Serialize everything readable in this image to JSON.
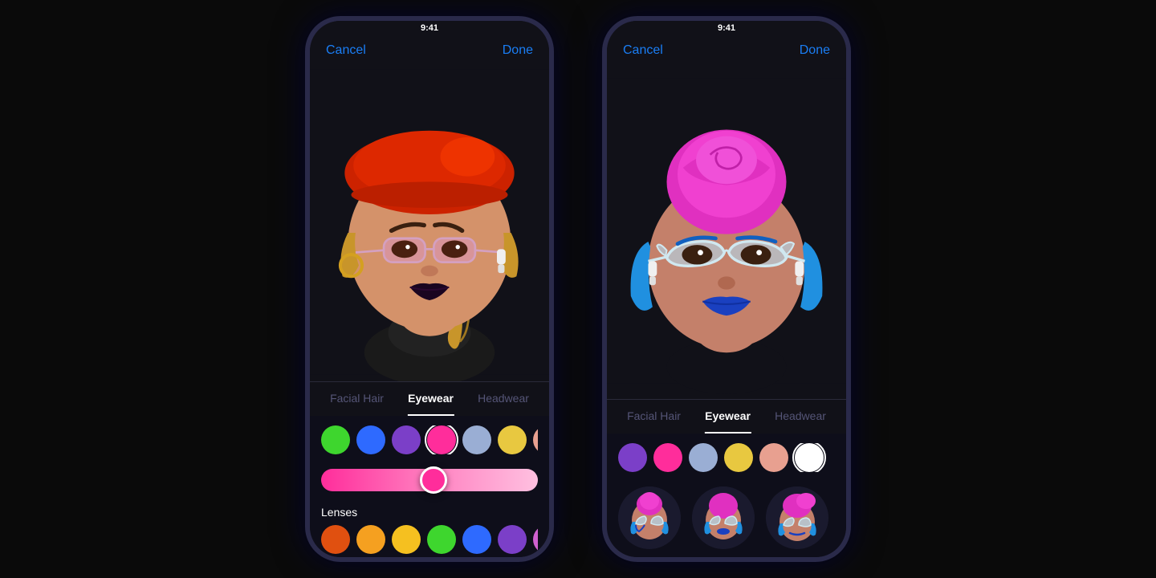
{
  "background": "#0a0a0a",
  "phones": [
    {
      "id": "left-phone",
      "statusTime": "9:41",
      "topBar": {
        "cancel": "Cancel",
        "done": "Done"
      },
      "tabs": [
        {
          "label": "Facial Hair",
          "active": false
        },
        {
          "label": "Eyewear",
          "active": true
        },
        {
          "label": "Headwear",
          "active": false
        }
      ],
      "colorRow": [
        {
          "color": "#3ed62e",
          "selected": false
        },
        {
          "color": "#2e6aff",
          "selected": false
        },
        {
          "color": "#7b3fc8",
          "selected": false
        },
        {
          "color": "#ff2d9b",
          "selected": true
        },
        {
          "color": "#9aaed4",
          "selected": false
        },
        {
          "color": "#e8c840",
          "selected": false
        },
        {
          "color": "#e8a090",
          "selected": false
        }
      ],
      "slider": {
        "gradient": "linear-gradient(to right, #ff2d9b, #ff6eb0, #ffaad4)",
        "thumbPosition": 52,
        "thumbColor": "#ff2d9b"
      },
      "lensesLabel": "Lenses",
      "lensesColors": [
        {
          "color": "#e05010",
          "selected": false
        },
        {
          "color": "#f5a020",
          "selected": false
        },
        {
          "color": "#f5c020",
          "selected": false
        },
        {
          "color": "#3ed62e",
          "selected": false
        },
        {
          "color": "#2e6aff",
          "selected": false
        },
        {
          "color": "#7b3fc8",
          "selected": false
        },
        {
          "color": "#d060d0",
          "selected": false
        }
      ]
    },
    {
      "id": "right-phone",
      "statusTime": "9:41",
      "topBar": {
        "cancel": "Cancel",
        "done": "Done"
      },
      "tabs": [
        {
          "label": "Facial Hair",
          "active": false
        },
        {
          "label": "Eyewear",
          "active": true
        },
        {
          "label": "Headwear",
          "active": false
        }
      ],
      "colorRow": [
        {
          "color": "#7b3fc8",
          "selected": false
        },
        {
          "color": "#ff2d9b",
          "selected": false
        },
        {
          "color": "#9aaed4",
          "selected": false
        },
        {
          "color": "#e8c840",
          "selected": false
        },
        {
          "color": "#e8a090",
          "selected": false
        },
        {
          "color": "#ffffff",
          "selected": true
        }
      ],
      "styleOptions": [
        {
          "bg": "#2a1a3a"
        },
        {
          "bg": "#1a2a3a"
        },
        {
          "bg": "#3a2a1a"
        }
      ]
    }
  ]
}
